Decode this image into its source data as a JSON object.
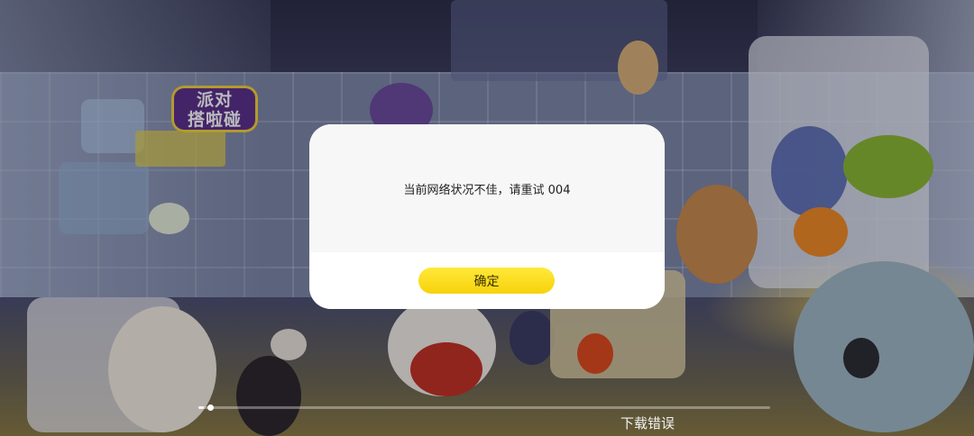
{
  "app": {
    "logo_text_line1": "派对",
    "logo_text_line2": "搭啦碰"
  },
  "dialog": {
    "message": "当前网络状况不佳，请重试 004",
    "confirm_label": "确定"
  },
  "loading": {
    "progress": 0.01,
    "status": "下载错误"
  },
  "colors": {
    "confirm_button": "#f7d20a",
    "dialog_bg": "#ffffff",
    "dialog_body_bg": "#f7f7f7"
  }
}
